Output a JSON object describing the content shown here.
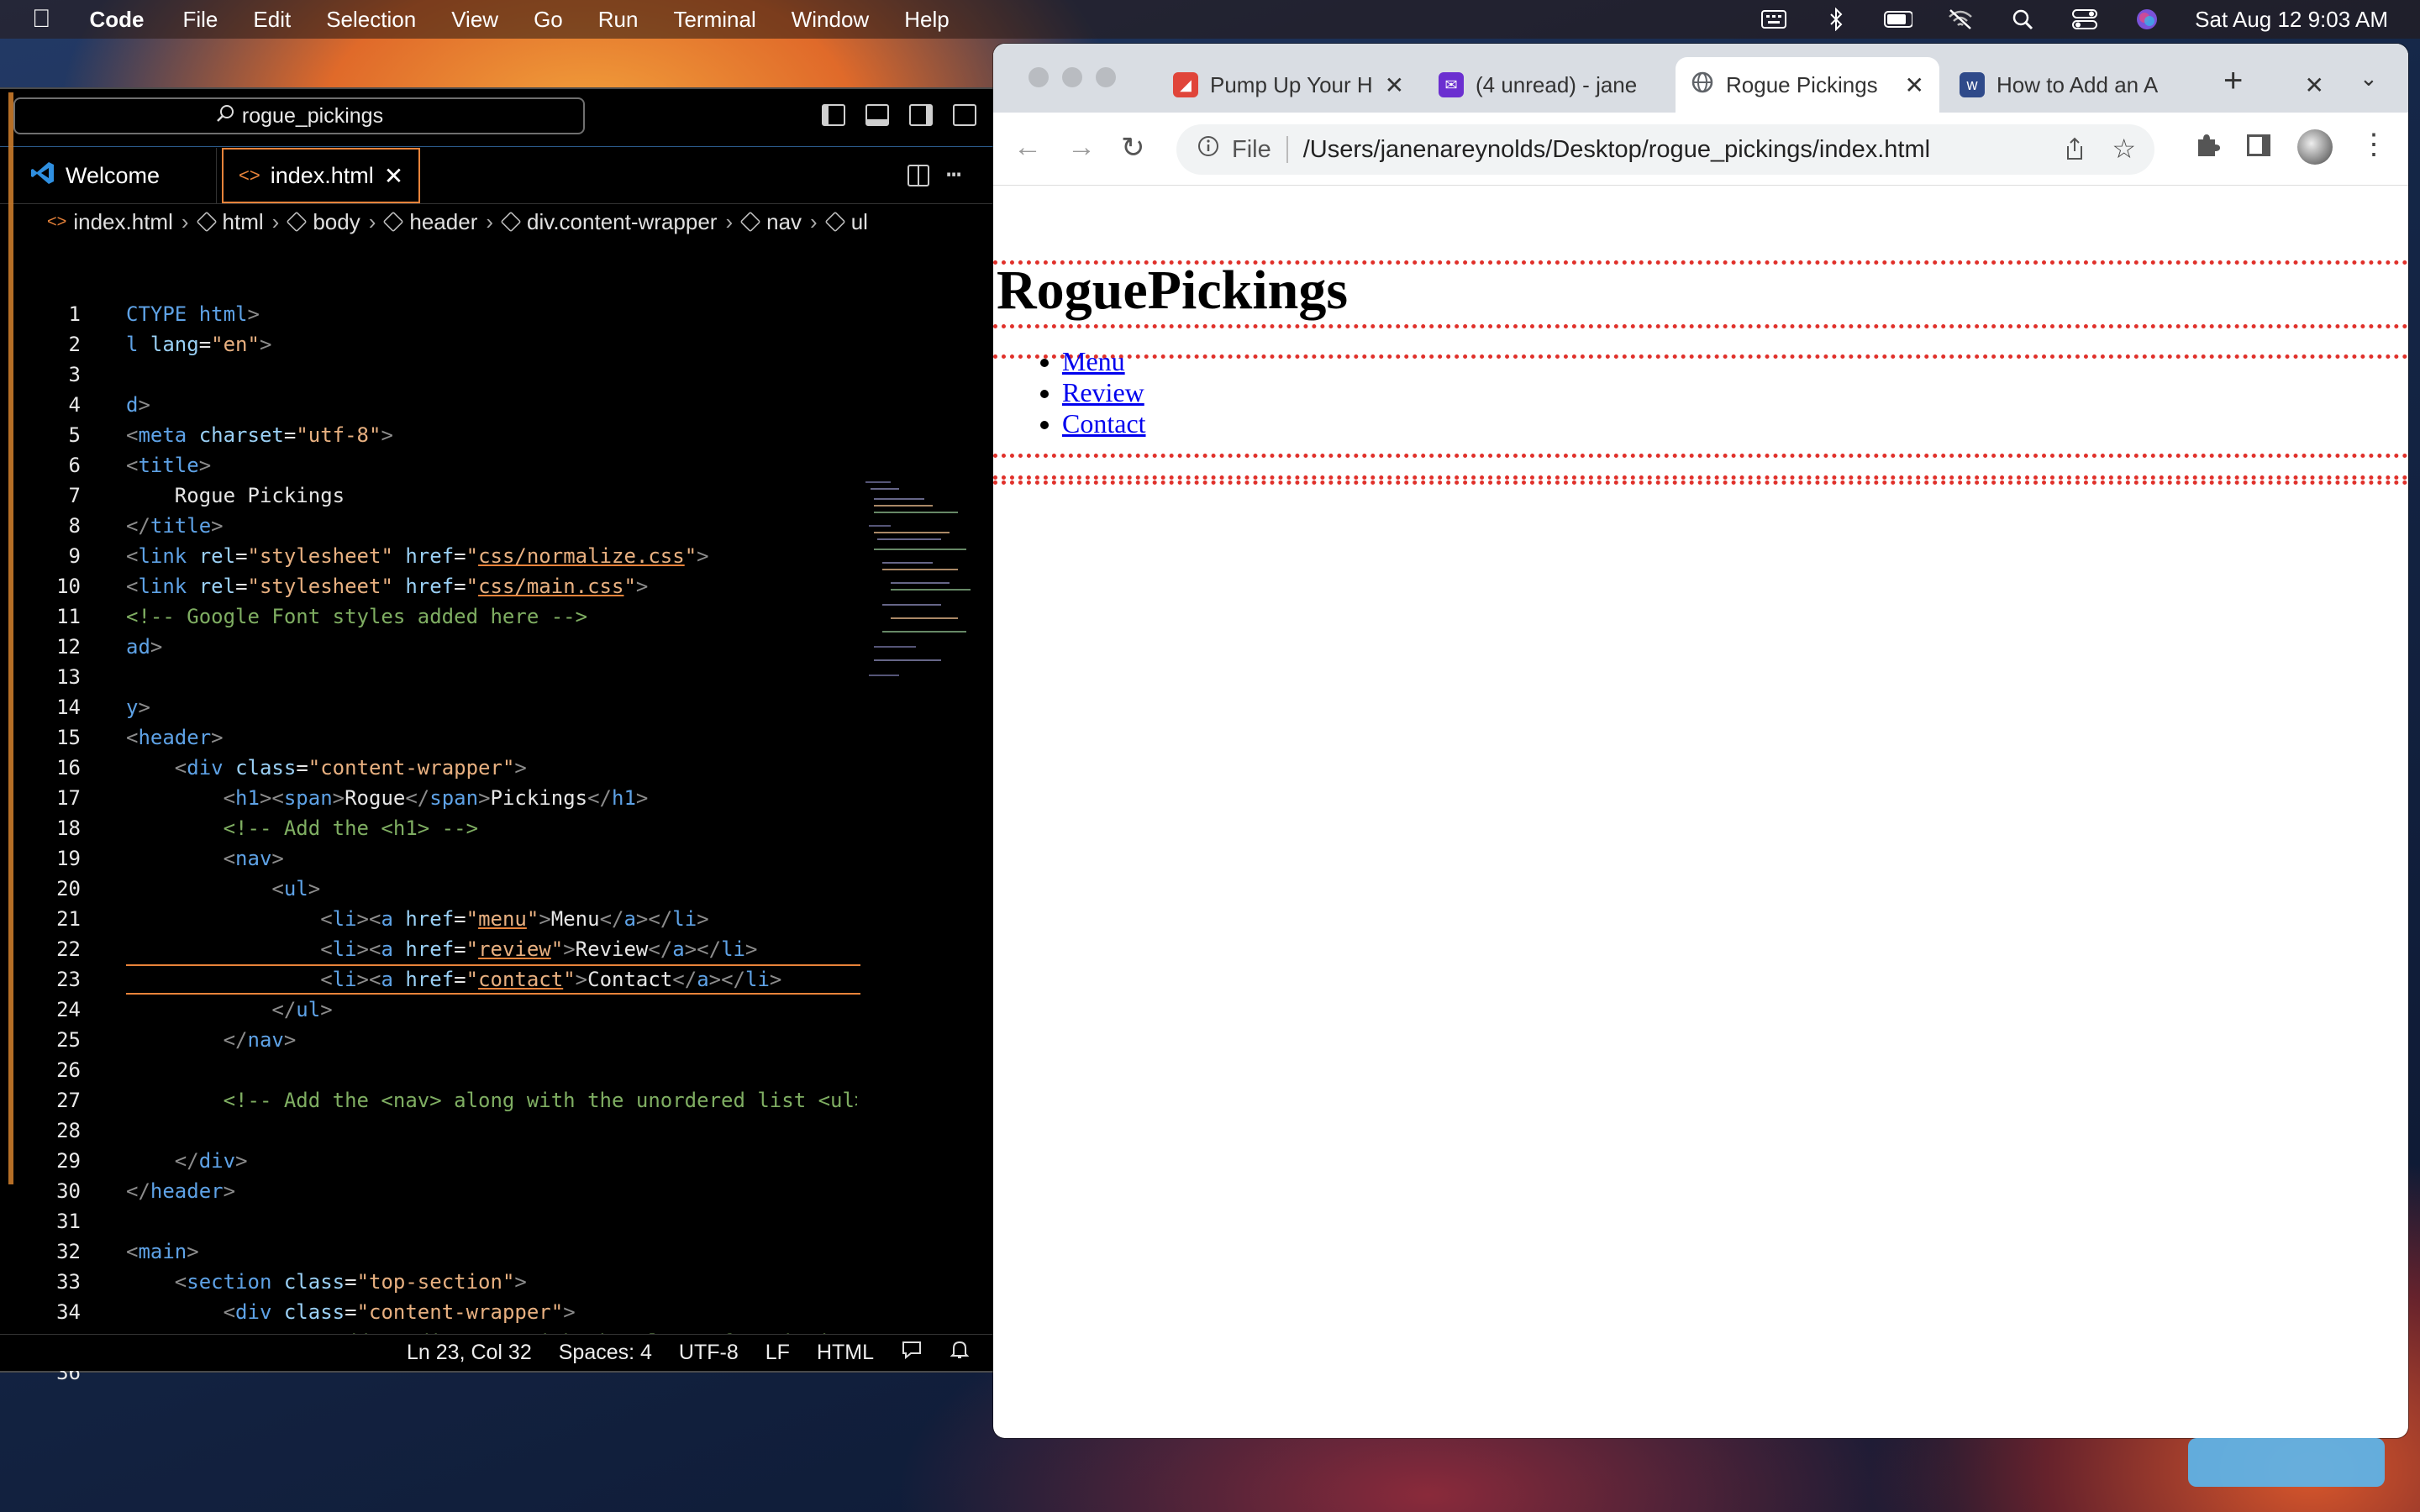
{
  "menubar": {
    "app": "Code",
    "items": [
      "File",
      "Edit",
      "Selection",
      "View",
      "Go",
      "Run",
      "Terminal",
      "Window",
      "Help"
    ],
    "clock": "Sat Aug 12  9:03 AM"
  },
  "vscode": {
    "search": "rogue_pickings",
    "tabs": {
      "welcome": "Welcome",
      "index": "index.html"
    },
    "breadcrumb": [
      "index.html",
      "html",
      "body",
      "header",
      "div.content-wrapper",
      "nav",
      "ul"
    ],
    "status": {
      "position": "Ln 23, Col 32",
      "spaces": "Spaces: 4",
      "encoding": "UTF-8",
      "eol": "LF",
      "language": "HTML"
    },
    "current_line": 23
  },
  "chrome": {
    "tabs": [
      {
        "title": "Pump Up Your H",
        "favicon_color": "#e0453a"
      },
      {
        "title": "(4 unread) - jane",
        "favicon_color": "#6b2fd0"
      },
      {
        "title": "Rogue Pickings",
        "favicon_color": "#5f6368"
      },
      {
        "title": "How to Add an A",
        "favicon_color": "#2f4a8a"
      }
    ],
    "address_prefix": "File",
    "url": "/Users/janenareynolds/Desktop/rogue_pickings/index.html"
  },
  "page": {
    "heading": "RoguePickings",
    "links": [
      "Menu",
      "Review",
      "Contact"
    ]
  }
}
